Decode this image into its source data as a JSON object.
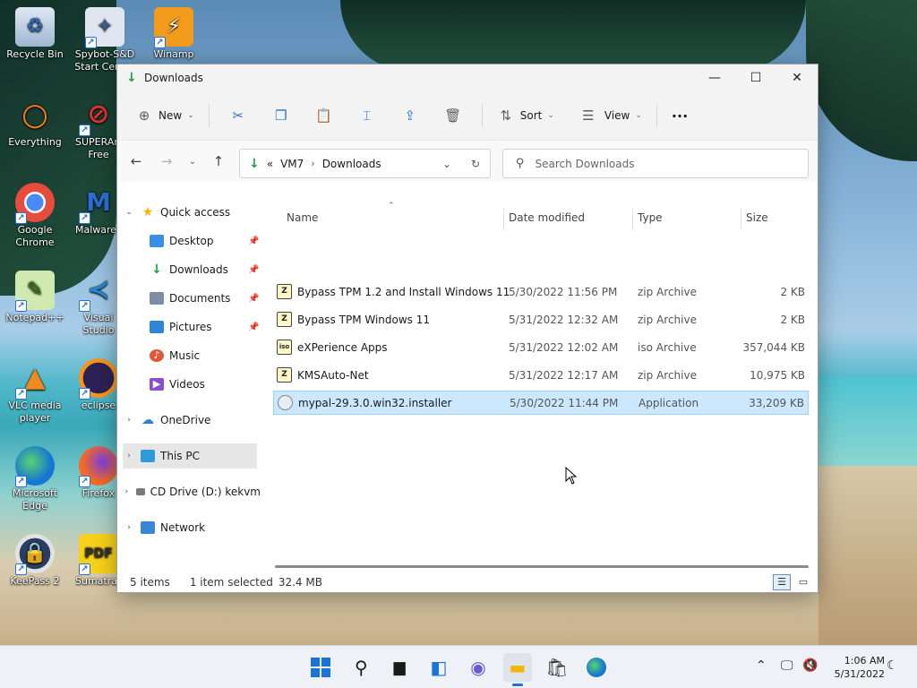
{
  "desktop": {
    "icons": [
      {
        "label": "Recycle Bin"
      },
      {
        "label": "Spybot-S&D Start Center"
      },
      {
        "label": "Winamp"
      },
      {
        "label": "Everything"
      },
      {
        "label": "SUPERAntiSpyware Free Edition"
      },
      {
        "label": "Google Chrome"
      },
      {
        "label": "Malwarebytes"
      },
      {
        "label": "Notepad++"
      },
      {
        "label": "Visual Studio Code"
      },
      {
        "label": "VLC media player"
      },
      {
        "label": "eclipse"
      },
      {
        "label": "Microsoft Edge"
      },
      {
        "label": "Firefox"
      },
      {
        "label": "KeePass 2"
      },
      {
        "label": "Sumatra PDF"
      }
    ]
  },
  "window": {
    "title": "Downloads",
    "controls": {
      "minimize": "—",
      "maximize": "☐",
      "close": "✕"
    }
  },
  "toolbar": {
    "new_label": "New",
    "sort_label": "Sort",
    "view_label": "View",
    "more_label": "···"
  },
  "address": {
    "overflow": "«",
    "crumbs": [
      "VM7",
      "Downloads"
    ],
    "separator": "›"
  },
  "search": {
    "placeholder": "Search Downloads"
  },
  "nav": {
    "quick_access": "Quick access",
    "items": [
      {
        "label": "Desktop",
        "pinned": true
      },
      {
        "label": "Downloads",
        "pinned": true
      },
      {
        "label": "Documents",
        "pinned": true
      },
      {
        "label": "Pictures",
        "pinned": true
      },
      {
        "label": "Music",
        "pinned": false
      },
      {
        "label": "Videos",
        "pinned": false
      }
    ],
    "onedrive": "OneDrive",
    "this_pc": "This PC",
    "cd_drive": "CD Drive (D:) kekvm",
    "network": "Network"
  },
  "columns": {
    "name": "Name",
    "date": "Date modified",
    "type": "Type",
    "size": "Size"
  },
  "files": [
    {
      "name": "Bypass TPM 1.2 and Install Windows 11",
      "date": "5/30/2022 11:56 PM",
      "type": "zip Archive",
      "size": "2 KB",
      "icon": "Z"
    },
    {
      "name": "Bypass TPM Windows 11",
      "date": "5/31/2022 12:32 AM",
      "type": "zip Archive",
      "size": "2 KB",
      "icon": "Z"
    },
    {
      "name": "eXPerience Apps",
      "date": "5/31/2022 12:02 AM",
      "type": "iso Archive",
      "size": "357,044 KB",
      "icon": "iso"
    },
    {
      "name": "KMSAuto-Net",
      "date": "5/31/2022 12:17 AM",
      "type": "zip Archive",
      "size": "10,975 KB",
      "icon": "Z"
    },
    {
      "name": "mypal-29.3.0.win32.installer",
      "date": "5/30/2022 11:44 PM",
      "type": "Application",
      "size": "33,209 KB",
      "icon": "app"
    }
  ],
  "status": {
    "count": "5 items",
    "selected": "1 item selected",
    "size": "32.4 MB"
  },
  "clock": {
    "time": "1:06 AM",
    "date": "5/31/2022"
  },
  "colors": {
    "accent": "#1a73d9",
    "selection": "#cce8ff",
    "downloads_green": "#1d9e4a"
  }
}
